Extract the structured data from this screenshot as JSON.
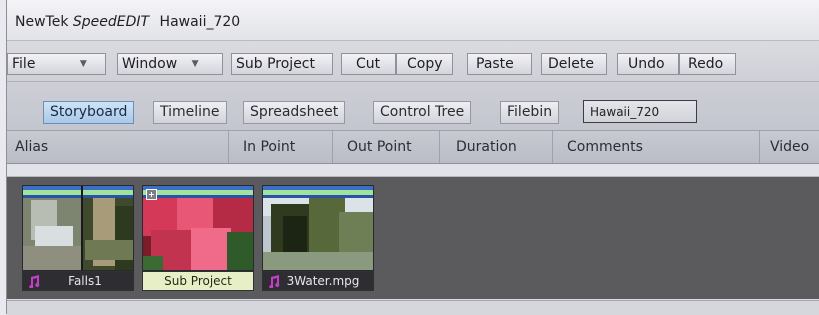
{
  "window": {
    "title_prefix": "NewTek",
    "title_brand": "SpeedEDIT",
    "title_project": "Hawaii_720"
  },
  "toolbar": {
    "file_label": "File",
    "window_label": "Window",
    "sub_project_label": "Sub Project",
    "cut_label": "Cut",
    "copy_label": "Copy",
    "paste_label": "Paste",
    "delete_label": "Delete",
    "undo_label": "Undo",
    "redo_label": "Redo"
  },
  "tabs": [
    {
      "label": "Storyboard",
      "active": true
    },
    {
      "label": "Timeline",
      "active": false
    },
    {
      "label": "Spreadsheet",
      "active": false
    },
    {
      "label": "Control Tree",
      "active": false
    },
    {
      "label": "Filebin",
      "active": false
    }
  ],
  "project_name_field": "Hawaii_720",
  "columns": [
    "Alias",
    "In Point",
    "Out Point",
    "Duration",
    "Comments",
    "Video"
  ],
  "clips": [
    {
      "label": "Falls1",
      "has_audio": true,
      "selected": false
    },
    {
      "label": "Sub Project",
      "has_audio": false,
      "selected": true
    },
    {
      "label": "3Water.mpg",
      "has_audio": true,
      "selected": false
    }
  ],
  "colors": {
    "active_tab": "#a9c8e8",
    "storyboard_bg": "#5b5b5e",
    "clip_bar_blue": "#3d6ec7",
    "clip_bar_green": "#9fe39c",
    "selected_label": "#e7efc6",
    "audio_icon": "#c23ec8"
  },
  "icons": {
    "dropdown": "chevron-down-icon",
    "audio": "music-note-icon",
    "subproject": "plus-icon"
  }
}
